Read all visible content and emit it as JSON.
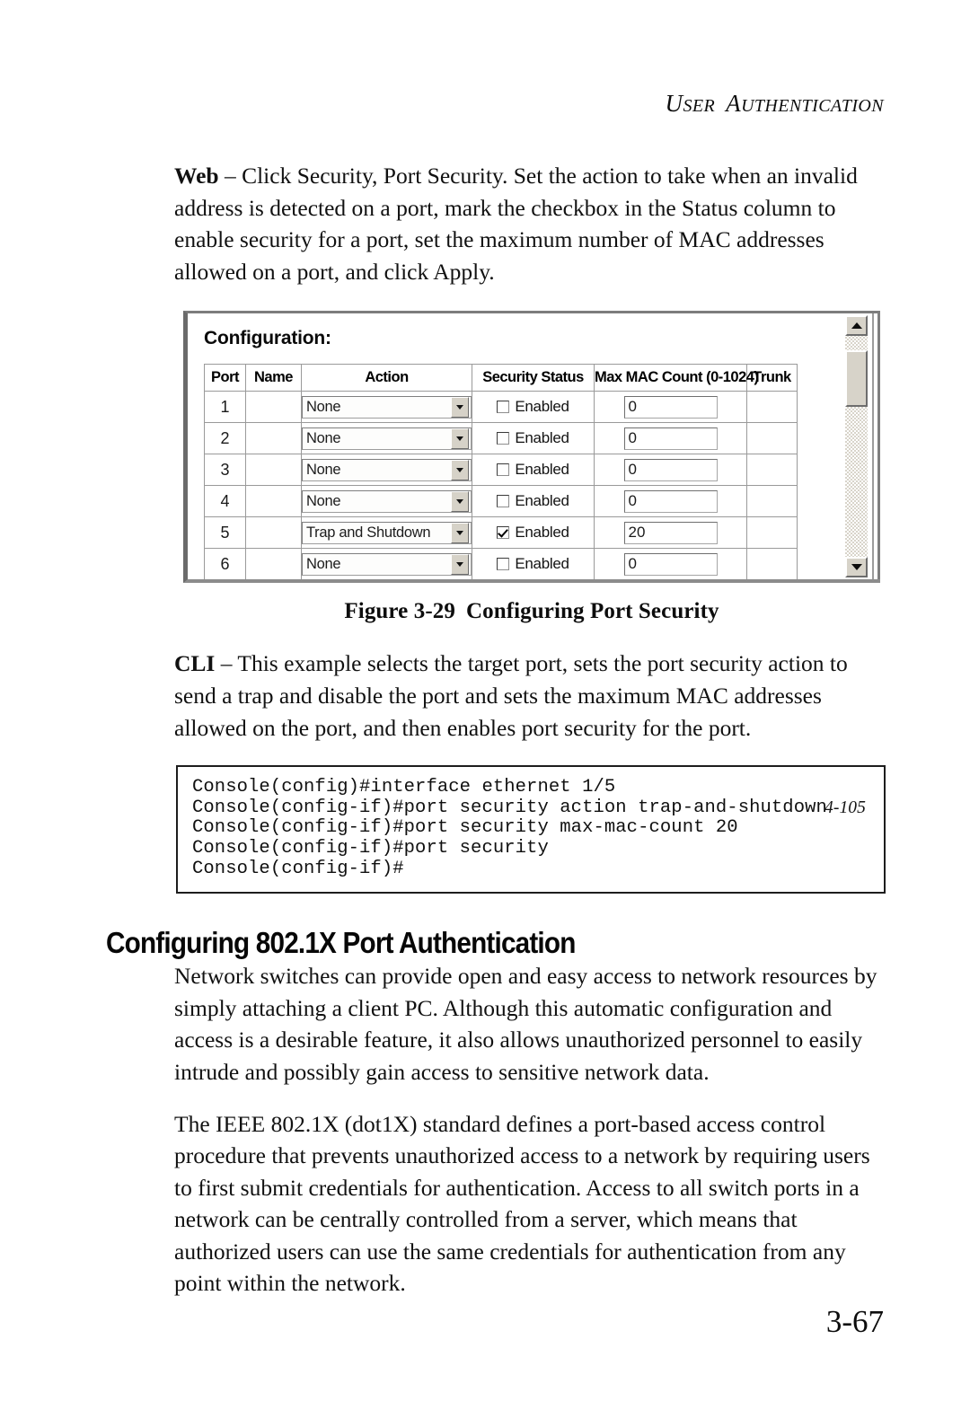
{
  "running_head": {
    "first_word": "User",
    "second_word": "Authentication"
  },
  "paragraphs": {
    "web": {
      "lead": "Web",
      "text": " – Click Security, Port Security. Set the action to take when an invalid address is detected on a port, mark the checkbox in the Status column to enable security for a port, set the maximum number of MAC addresses allowed on a port, and click Apply."
    },
    "cli": {
      "lead": "CLI",
      "text": " – This example selects the target port, sets the port security action to send a trap and disable the port and sets the maximum MAC addresses allowed on the port, and then enables port security for the port."
    },
    "intro_802": "Network switches can provide open and easy access to network resources by simply attaching a client PC. Although this automatic configuration and access is a desirable feature, it also allows unauthorized personnel to easily intrude and possibly gain access to sensitive network data.",
    "ieee_802": "The IEEE 802.1X (dot1X) standard defines a port-based access control procedure that prevents unauthorized access to a network by requiring users to first submit credentials for authentication. Access to all switch ports in a network can be centrally controlled from a server, which means that authorized users can use the same credentials for authentication from any point within the network."
  },
  "figure": {
    "panel_title": "Configuration:",
    "columns": [
      "Port",
      "Name",
      "Action",
      "Security Status",
      "Max MAC Count (0-1024)",
      "Trunk"
    ],
    "rows": [
      {
        "port": "1",
        "name": "",
        "action": "None",
        "security_enabled": false,
        "security_label": "Enabled",
        "max_mac_count": "0",
        "trunk": ""
      },
      {
        "port": "2",
        "name": "",
        "action": "None",
        "security_enabled": false,
        "security_label": "Enabled",
        "max_mac_count": "0",
        "trunk": ""
      },
      {
        "port": "3",
        "name": "",
        "action": "None",
        "security_enabled": false,
        "security_label": "Enabled",
        "max_mac_count": "0",
        "trunk": ""
      },
      {
        "port": "4",
        "name": "",
        "action": "None",
        "security_enabled": false,
        "security_label": "Enabled",
        "max_mac_count": "0",
        "trunk": ""
      },
      {
        "port": "5",
        "name": "",
        "action": "Trap and Shutdown",
        "security_enabled": true,
        "security_label": "Enabled",
        "max_mac_count": "20",
        "trunk": ""
      },
      {
        "port": "6",
        "name": "",
        "action": "None",
        "security_enabled": false,
        "security_label": "Enabled",
        "max_mac_count": "0",
        "trunk": ""
      }
    ],
    "scrollbar": {
      "up_icon": "triangle-up-icon",
      "down_icon": "triangle-down-icon"
    },
    "caption_number": "Figure 3-29",
    "caption_title": "Configuring Port Security"
  },
  "cli_block": {
    "lines": [
      "Console(config)#interface ethernet 1/5",
      "Console(config-if)#port security action trap-and-shutdown",
      "Console(config-if)#port security max-mac-count 20",
      "Console(config-if)#port security",
      "Console(config-if)#"
    ],
    "xref": "4-105"
  },
  "section_heading": "Configuring 802.1X Port Authentication",
  "folio": "3-67",
  "colors": {
    "text": "#111111",
    "window_border": "#6b6b6b",
    "table_border": "#9a9a9a",
    "control_face": "#d7d3c9"
  }
}
